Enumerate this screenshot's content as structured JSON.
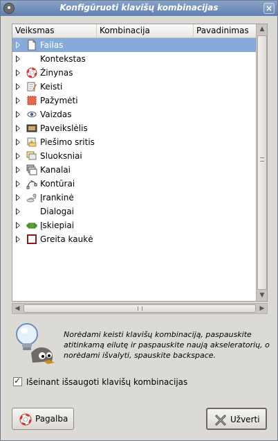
{
  "window": {
    "title": "Konfigūruoti klavišų kombinacijas"
  },
  "table": {
    "columns": [
      "Veiksmas",
      "Kombinacija",
      "Pavadinimas"
    ],
    "rows": [
      {
        "label": "Failas",
        "icon": "file-icon",
        "selected": true
      },
      {
        "label": "Kontekstas",
        "icon": "none",
        "selected": false
      },
      {
        "label": "Žinynas",
        "icon": "lifebuoy-icon",
        "selected": false
      },
      {
        "label": "Keisti",
        "icon": "edit-icon",
        "selected": false
      },
      {
        "label": "Pažymėti",
        "icon": "selection-icon",
        "selected": false
      },
      {
        "label": "Vaizdas",
        "icon": "eye-icon",
        "selected": false
      },
      {
        "label": "Paveikslėlis",
        "icon": "image-icon",
        "selected": false
      },
      {
        "label": "Piešimo sritis",
        "icon": "drawable-icon",
        "selected": false
      },
      {
        "label": "Sluoksniai",
        "icon": "layers-icon",
        "selected": false
      },
      {
        "label": "Kanalai",
        "icon": "channels-icon",
        "selected": false
      },
      {
        "label": "Kontūrai",
        "icon": "paths-icon",
        "selected": false
      },
      {
        "label": "Įrankinė",
        "icon": "tools-icon",
        "selected": false
      },
      {
        "label": "Dialogai",
        "icon": "none",
        "selected": false
      },
      {
        "label": "Įskiepiai",
        "icon": "plugin-icon",
        "selected": false
      },
      {
        "label": "Greita kaukė",
        "icon": "quickmask-icon",
        "selected": false
      }
    ]
  },
  "hint": {
    "text": "Norėdami keisti klavišų kombinaciją, paspauskite atitinkamą eilutę ir paspauskite naują akseleratorių, o norėdami išvalyti, spauskite backspace."
  },
  "save_on_exit": {
    "label": "Išeinant išsaugoti klavišų kombinacijas",
    "checked": true
  },
  "buttons": {
    "help": "Pagalba",
    "close": "Užverti"
  }
}
